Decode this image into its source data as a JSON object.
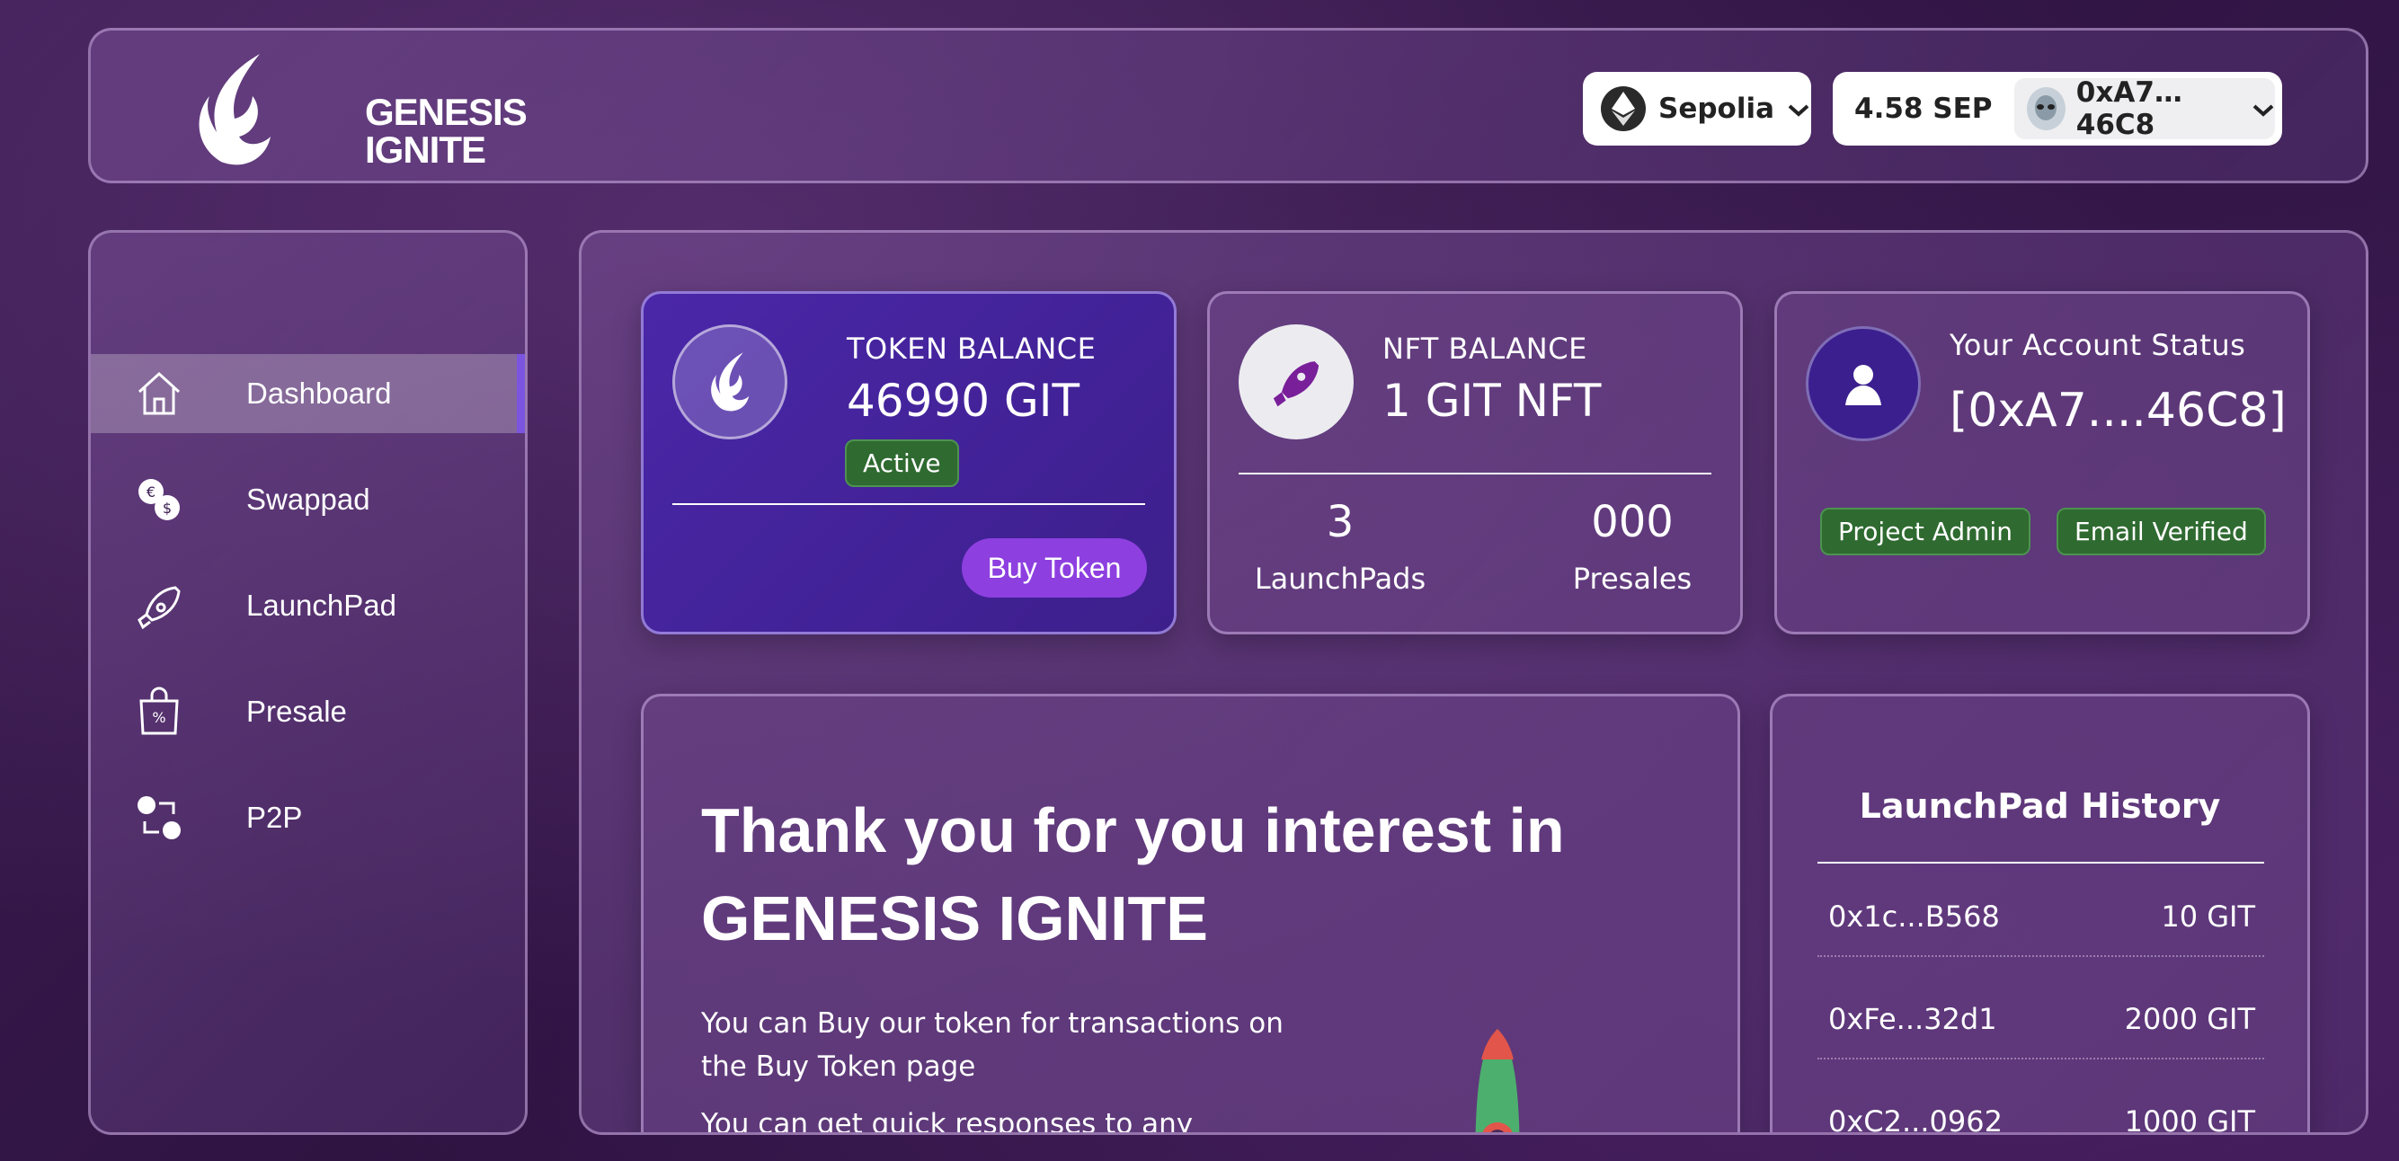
{
  "header": {
    "logo_line1": "GENESIS",
    "logo_line2": "IGNITE",
    "network": "Sepolia",
    "balance": "4.58 SEP",
    "address": "0xA7…2...46C8"
  },
  "sidebar": {
    "items": [
      {
        "label": "Dashboard",
        "icon": "home-icon",
        "active": true
      },
      {
        "label": "Swappad",
        "icon": "currency-swap-icon",
        "active": false
      },
      {
        "label": "LaunchPad",
        "icon": "rocket-icon",
        "active": false
      },
      {
        "label": "Presale",
        "icon": "presale-bag-icon",
        "active": false
      },
      {
        "label": "P2P",
        "icon": "p2p-icon",
        "active": false
      }
    ]
  },
  "token_card": {
    "title": "TOKEN BALANCE",
    "value": "46990 GIT",
    "badge": "Active",
    "button": "Buy Token"
  },
  "nft_card": {
    "title": "NFT BALANCE",
    "value": "1 GIT NFT",
    "stats": [
      {
        "value": "3",
        "label": "LaunchPads"
      },
      {
        "value": "000",
        "label": "Presales"
      }
    ]
  },
  "status_card": {
    "title": "Your Account Status",
    "address": "[0xA7....46C8]",
    "badges": [
      "Project Admin",
      "Email Verified"
    ]
  },
  "intro": {
    "title": "Thank you for you interest in GENESIS IGNITE",
    "paragraphs": [
      "You can Buy our token for transactions on the Buy Token page",
      "You can get quick responses to any"
    ]
  },
  "history": {
    "title": "LaunchPad History",
    "rows": [
      {
        "address": "0x1c...B568",
        "amount": "10 GIT"
      },
      {
        "address": "0xFe...32d1",
        "amount": "2000 GIT"
      },
      {
        "address": "0xC2...0962",
        "amount": "1000 GIT"
      }
    ]
  },
  "colors": {
    "accent_purple": "#8d3fe0",
    "token_card_bg": "#4a27a8",
    "badge_green": "#2f6a30"
  }
}
